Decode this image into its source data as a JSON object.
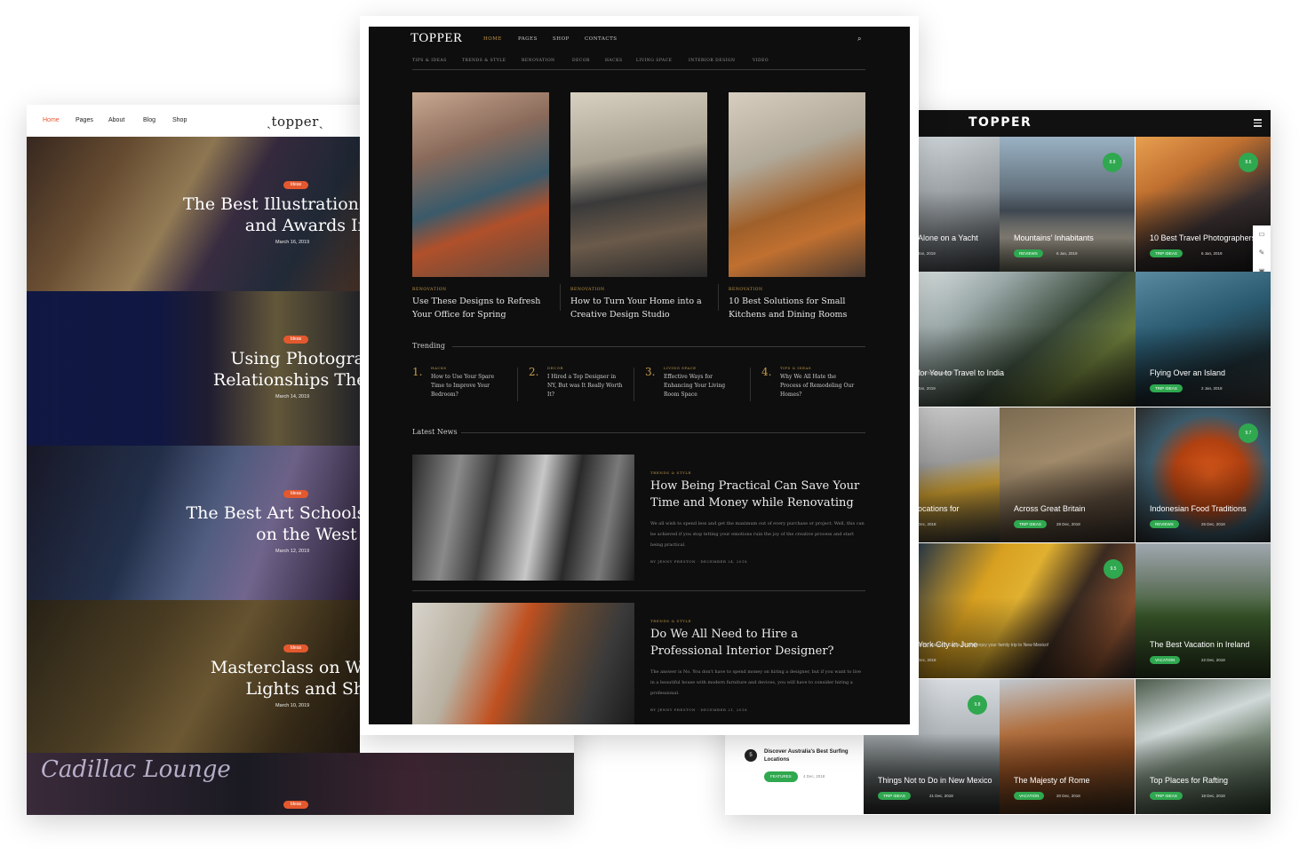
{
  "left": {
    "nav": [
      "Home",
      "Pages",
      "About",
      "Blog",
      "Shop"
    ],
    "logo": "ˎtopperˎ",
    "posts": [
      {
        "badge": "Ideas",
        "title": "The Best Illustration Cor\nand Awards In 20",
        "date": "March 16, 2019"
      },
      {
        "badge": "Ideas",
        "title": "Using Photography\nRelationships Therap",
        "date": "March 14, 2019"
      },
      {
        "badge": "Ideas",
        "title": "The Best Art Schools for\non the West Coa",
        "date": "March 12, 2019"
      },
      {
        "badge": "Ideas",
        "title": "Masterclass on Worki\nLights and Shado",
        "date": "March 10, 2019"
      }
    ],
    "bottom_sign": "Cadillac Lounge",
    "bottom_badge": "Ideas"
  },
  "center": {
    "logo": "TOPPER",
    "nav": [
      {
        "label": "HOME",
        "active": true
      },
      {
        "label": "PAGES",
        "active": false
      },
      {
        "label": "SHOP",
        "active": false
      },
      {
        "label": "CONTACTS",
        "active": false
      }
    ],
    "categories": [
      "TIPS & IDEAS",
      "TRENDS & STYLE",
      "RENOVATION",
      "DECOR",
      "HACKS",
      "LIVING SPACE",
      "INTERIOR DESIGN",
      "VIDEO"
    ],
    "featured": [
      {
        "category": "RENOVATION",
        "title": "Use These Designs to Refresh Your Office for Spring"
      },
      {
        "category": "RENOVATION",
        "title": "How to Turn Your Home into a Creative Design Studio"
      },
      {
        "category": "RENOVATION",
        "title": "10 Best Solutions for Small Kitchens and Dining Rooms"
      }
    ],
    "trending_label": "Trending",
    "trending": [
      {
        "num": "1.",
        "category": "HACKS",
        "title": "How to Use Your Spare Time to Improve Your Bedroom?"
      },
      {
        "num": "2.",
        "category": "DECOR",
        "title": "I Hired a Top Designer in NY, But was It Really Worth It?"
      },
      {
        "num": "3.",
        "category": "LIVING SPACE",
        "title": "Effective Ways for Enhancing Your Living Room Space"
      },
      {
        "num": "4.",
        "category": "TIPS & IDEAS",
        "title": "Why We All Hate the Process of Remodeling Our Homes?"
      }
    ],
    "latest_label": "Latest News",
    "latest": [
      {
        "category": "TRENDS & STYLE",
        "title": "How Being Practical Can Save Your Time and Money while Renovating",
        "excerpt": "We all wish to spend less and get the maximum out of every purchase or project. Well, this can be achieved if you stop letting your emotions ruin the joy of the creative process and start being practical.",
        "meta": "BY JENNY PRESTON  ·  DECEMBER 24, 2018"
      },
      {
        "category": "TRENDS & STYLE",
        "title": "Do We All Need to Hire a Professional Interior Designer?",
        "excerpt": "The answer is No. You don't have to spend money on hiring a designer, but if you want to live in a beautiful house with modern furniture and devices, you will have to consider hiring a professional.",
        "meta": "BY JENNY PRESTON  ·  DECEMBER 21, 2018"
      }
    ]
  },
  "right": {
    "logo": "TOPPER",
    "tiles": [
      {
        "title": "Alone on a Yacht",
        "tag": "",
        "date": "Jan, 2019",
        "score": ""
      },
      {
        "title": "Mountains' Inhabitants",
        "tag": "REVIEWS",
        "date": "6 Jan, 2019",
        "score": "8.8"
      },
      {
        "title": "10 Best Travel Photographers",
        "tag": "TRIP IDEAS",
        "date": "6 Jan, 2019",
        "score": "8.6"
      },
      {
        "title": "for You to Travel to India",
        "tag": "",
        "date": "Jan, 2019",
        "score": "",
        "excerpt": "ry to have seen it!"
      },
      {
        "title": "Flying Over an Island",
        "tag": "TRIP IDEAS",
        "date": "2 Jan, 2019",
        "score": ""
      },
      {
        "title": "ocations for",
        "tag": "",
        "date": "Dec, 2018",
        "score": ""
      },
      {
        "title": "Across Great Britain",
        "tag": "TRIP IDEAS",
        "date": "28 Dec, 2018",
        "score": ""
      },
      {
        "title": "Indonesian Food Traditions",
        "tag": "REVIEWS",
        "date": "26 Dec, 2018",
        "score": "9.7"
      },
      {
        "title": "York City in June",
        "tag": "",
        "date": "Dec, 2018",
        "score": "9.5",
        "excerpt": "azing places in Santa Fe and enjoy your family trip to New Mexico!"
      },
      {
        "title": "The Best Vacation in Ireland",
        "tag": "VACATION",
        "date": "22 Dec, 2018",
        "score": ""
      },
      {
        "title": "Things Not to Do in New Mexico",
        "tag": "TRIP IDEAS",
        "date": "21 Dec, 2018",
        "score": "9.8"
      },
      {
        "title": "The Majesty of Rome",
        "tag": "VACATION",
        "date": "20 Dec, 2018",
        "score": ""
      },
      {
        "title": "Top Places for Rafting",
        "tag": "TRIP IDEAS",
        "date": "18 Dec, 2018",
        "score": ""
      }
    ],
    "list_item": {
      "num": "5",
      "title": "Discover Australia's Best Surfing Locations",
      "tag": "FEATURES",
      "date": "4 Dec, 2018"
    }
  }
}
